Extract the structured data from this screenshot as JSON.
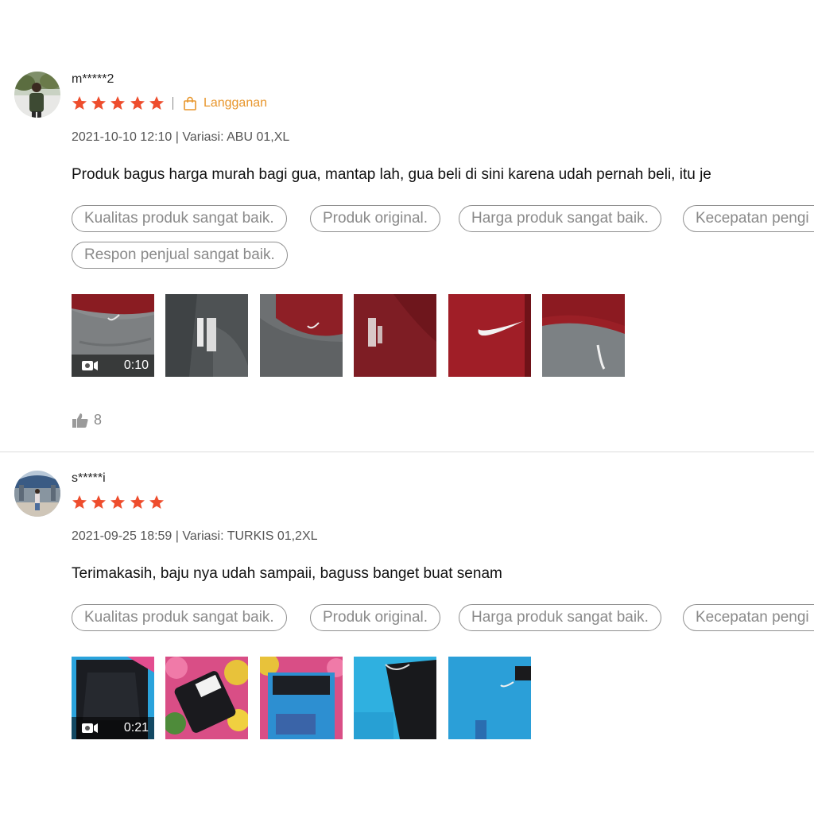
{
  "reviews": [
    {
      "username": "m*****2",
      "rating": 5,
      "subscription_label": "Langganan",
      "meta": "2021-10-10 12:10 | Variasi: ABU 01,XL",
      "comment": "Produk bagus harga murah bagi gua, mantap lah, gua beli di sini karena udah pernah beli, itu je",
      "tags": [
        "Kualitas produk sangat baik.",
        "Produk original.",
        "Harga produk sangat baik.",
        "Kecepatan pengi",
        "Respon penjual sangat baik."
      ],
      "video_duration": "0:10",
      "likes": "8"
    },
    {
      "username": "s*****i",
      "rating": 5,
      "meta": "2021-09-25 18:59 | Variasi: TURKIS 01,2XL",
      "comment": "Terimakasih, baju nya udah sampaii, baguss banget buat senam",
      "tags": [
        "Kualitas produk sangat baik.",
        "Produk original.",
        "Harga produk sangat baik.",
        "Kecepatan pengi"
      ],
      "video_duration": "0:21"
    }
  ],
  "colors": {
    "star": "#ee4d2d",
    "subscription": "#e8962c",
    "tag_border": "#8f8f8f",
    "tag_text": "#8a8a8a",
    "like": "#9a9a9a"
  },
  "icons": {
    "star": "star-icon",
    "subscription": "shopping-bag-icon",
    "video": "video-camera-icon",
    "like": "thumbs-up-icon"
  }
}
